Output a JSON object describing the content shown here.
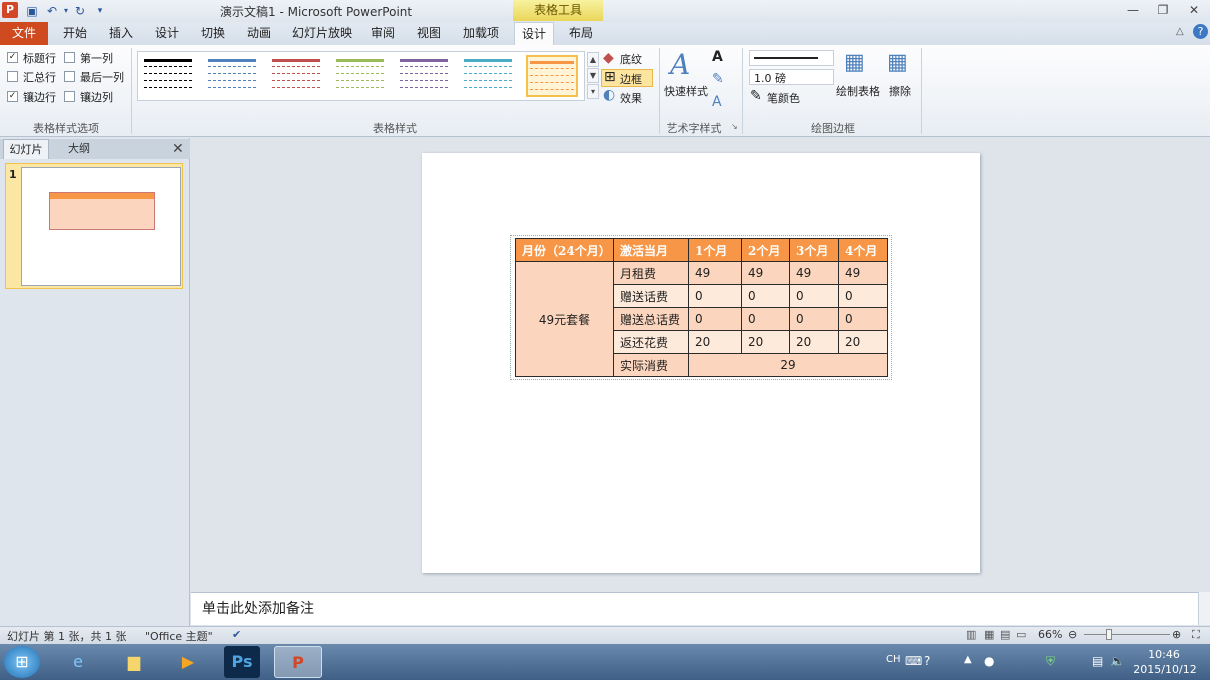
{
  "window": {
    "title": "演示文稿1 - Microsoft PowerPoint",
    "context_tab_title": "表格工具"
  },
  "tabs": [
    "文件",
    "开始",
    "插入",
    "设计",
    "切换",
    "动画",
    "幻灯片放映",
    "审阅",
    "视图",
    "加载项",
    "设计",
    "布局"
  ],
  "ribbon": {
    "options": {
      "header_row": "标题行",
      "first_col": "第一列",
      "total_row": "汇总行",
      "last_col": "最后一列",
      "banded_rows": "镶边行",
      "banded_cols": "镶边列",
      "group_label": "表格样式选项"
    },
    "styles_label": "表格样式",
    "shading": "底纹",
    "borders": "边框",
    "effects": "效果",
    "quick_styles": "快速样式",
    "wordart_label": "艺术字样式",
    "pen_weight": "1.0 磅",
    "pen_color": "笔颜色",
    "draw_table": "绘制表格",
    "eraser": "擦除",
    "draw_borders_label": "绘图边框",
    "style_colors": [
      "#000000",
      "#4f81bd",
      "#c0504d",
      "#9bbb59",
      "#8064a2",
      "#4bacc6",
      "#f79646"
    ]
  },
  "pane": {
    "tab_slides": "幻灯片",
    "tab_outline": "大纲",
    "slide_number": "1"
  },
  "table": {
    "header": [
      "月份（24个月）",
      "激活当月",
      "1个月",
      "2个月",
      "3个月",
      "4个月"
    ],
    "merged_label": "49元套餐",
    "rows": [
      {
        "name": "月租费",
        "values": [
          "49",
          "49",
          "49",
          "49"
        ]
      },
      {
        "name": "赠送话费",
        "values": [
          "0",
          "0",
          "0",
          "0"
        ]
      },
      {
        "name": "赠送总话费",
        "values": [
          "0",
          "0",
          "0",
          "0"
        ]
      },
      {
        "name": "返还花费",
        "values": [
          "20",
          "20",
          "20",
          "20"
        ]
      }
    ],
    "last_row": {
      "name": "实际消费",
      "value": "29"
    }
  },
  "notes_placeholder": "单击此处添加备注",
  "status": {
    "slide_info": "幻灯片 第 1 张，共 1 张",
    "theme": "\"Office 主题\"",
    "zoom": "66%"
  },
  "taskbar": {
    "lang": "CH",
    "time": "10:46",
    "date": "2015/10/12"
  }
}
